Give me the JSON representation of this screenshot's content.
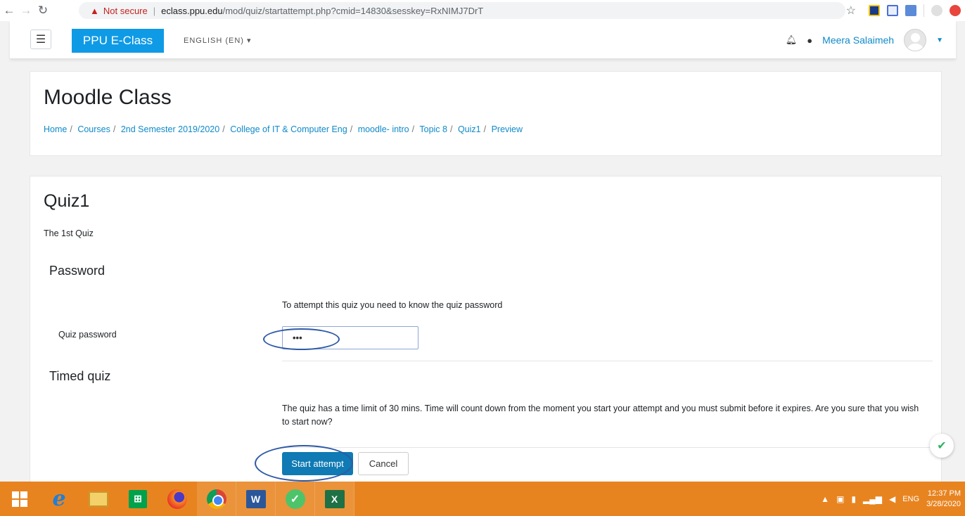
{
  "browser": {
    "security_label": "Not secure",
    "url_host": "eclass.ppu.edu",
    "url_path": "/mod/quiz/startattempt.php?cmid=14830&sesskey=RxNIMJ7DrT"
  },
  "navbar": {
    "brand": "PPU E-Class",
    "language": "ENGLISH (EN) ▾",
    "user_name": "Meera Salaimeh"
  },
  "header": {
    "course_title": "Moodle Class",
    "breadcrumb": [
      "Home",
      "Courses",
      "2nd Semester 2019/2020",
      "College of IT & Computer Eng",
      "moodle- intro",
      "Topic 8",
      "Quiz1",
      "Preview"
    ]
  },
  "quiz": {
    "title": "Quiz1",
    "intro": "The 1st Quiz",
    "password_section": "Password",
    "password_note": "To attempt this quiz you need to know the quiz password",
    "password_label": "Quiz password",
    "password_value": "•••",
    "timed_section": "Timed quiz",
    "timed_text": "The quiz has a time limit of 30 mins. Time will count down from the moment you start your attempt and you must submit before it expires. Are you sure that you wish to start now?",
    "start_label": "Start attempt",
    "cancel_label": "Cancel"
  },
  "taskbar": {
    "lang": "ENG",
    "time": "12:37 PM",
    "date": "3/28/2020"
  },
  "colors": {
    "accent": "#0f7ab3",
    "brand": "#0f9ae6",
    "taskbar": "#e88420",
    "annotation": "#2e5aa6"
  }
}
